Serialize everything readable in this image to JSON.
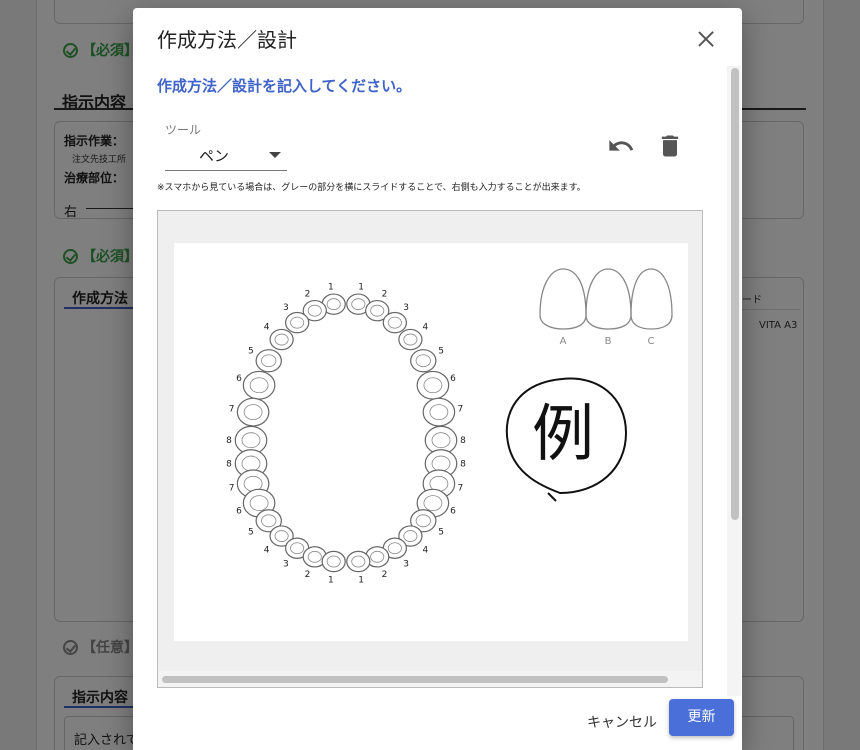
{
  "background": {
    "required_label_1": "【必須】",
    "section_heading_instructions": "指示内容",
    "instruction_work_label": "指示作業：",
    "instruction_work_value": "注文先技工所",
    "treatment_site_label": "治療部位：",
    "side_label": "右",
    "required_label_2": "【必須】",
    "method_heading_clipped": "作成方法",
    "shade_label_clipped": "ード",
    "shade_value": "VITA A3",
    "optional_label": "【任意】",
    "instructions_heading_clipped": "指示内容",
    "entered_text_clipped": "記入されて"
  },
  "dialog": {
    "title": "作成方法／設計",
    "instruction": "作成方法／設計を記入してください。",
    "tool": {
      "label": "ツール",
      "selected": "ペン"
    },
    "note": "※スマホから見ている場合は、グレーの部分を横にスライドすることで、右側も入力することが出来ます。",
    "diagram": {
      "upper_numbers": [
        "1",
        "2",
        "3",
        "4",
        "5",
        "6",
        "7",
        "8"
      ],
      "lower_numbers": [
        "8",
        "7",
        "6",
        "5",
        "4",
        "3",
        "2",
        "1"
      ],
      "shade_letters": [
        "A",
        "B",
        "C"
      ],
      "example_char": "例"
    },
    "cancel_label": "キャンセル",
    "update_label": "更新"
  },
  "colors": {
    "accent_blue": "#3f63c8",
    "button_blue": "#4a6fd8",
    "required_green": "#3aa24a"
  }
}
